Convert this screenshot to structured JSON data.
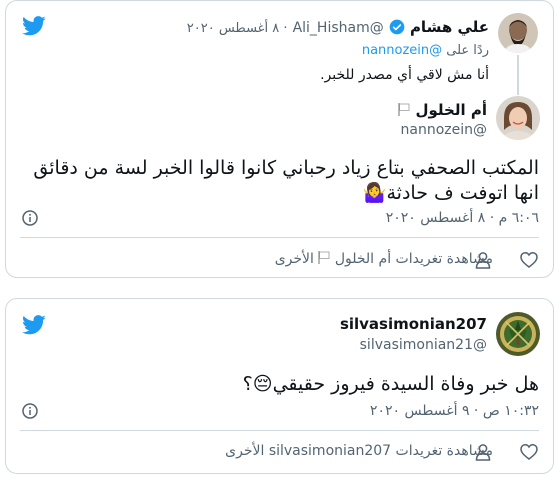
{
  "colors": {
    "accent": "#1d9bf0",
    "muted": "#536471",
    "border": "#cfd9de"
  },
  "tweet1": {
    "quoted": {
      "name": "علي هشام",
      "handle": "@Ali_Hisham",
      "date": "٨ أغسطس ٢٠٢٠",
      "reply_prefix": "ردًا على",
      "reply_mention": "@nannozein",
      "text": "أنا مش لاقي أي مصدر للخبر."
    },
    "main": {
      "name": "أم الخلول",
      "handle": "@nannozein",
      "line1": "المكتب الصحفي بتاع زياد رحباني كانوا قالوا الخبر لسة من دقائق",
      "line2": "انها اتوفت ف حادثة",
      "emoji": "🤷‍♀️",
      "timestamp": "٦:٠٦ م · ٨ أغسطس ٢٠٢٠",
      "view_more": "مشاهدة تغريدات أم الخلول",
      "other": "الأخرى"
    }
  },
  "tweet2": {
    "name": "silvasimonian207",
    "handle": "@silvasimonian21",
    "text": "هل خبر وفاة السيدة فيروز حقيقي",
    "emoji": "😔",
    "qmark": "؟",
    "timestamp": "١٠:٣٢ ص · ٩ أغسطس ٢٠٢٠",
    "view_more": "مشاهدة تغريدات silvasimonian207 الأخرى"
  },
  "icons": [
    "twitter-bird-icon",
    "verified-badge-icon",
    "flag-icon",
    "info-icon",
    "user-icon",
    "heart-icon"
  ]
}
